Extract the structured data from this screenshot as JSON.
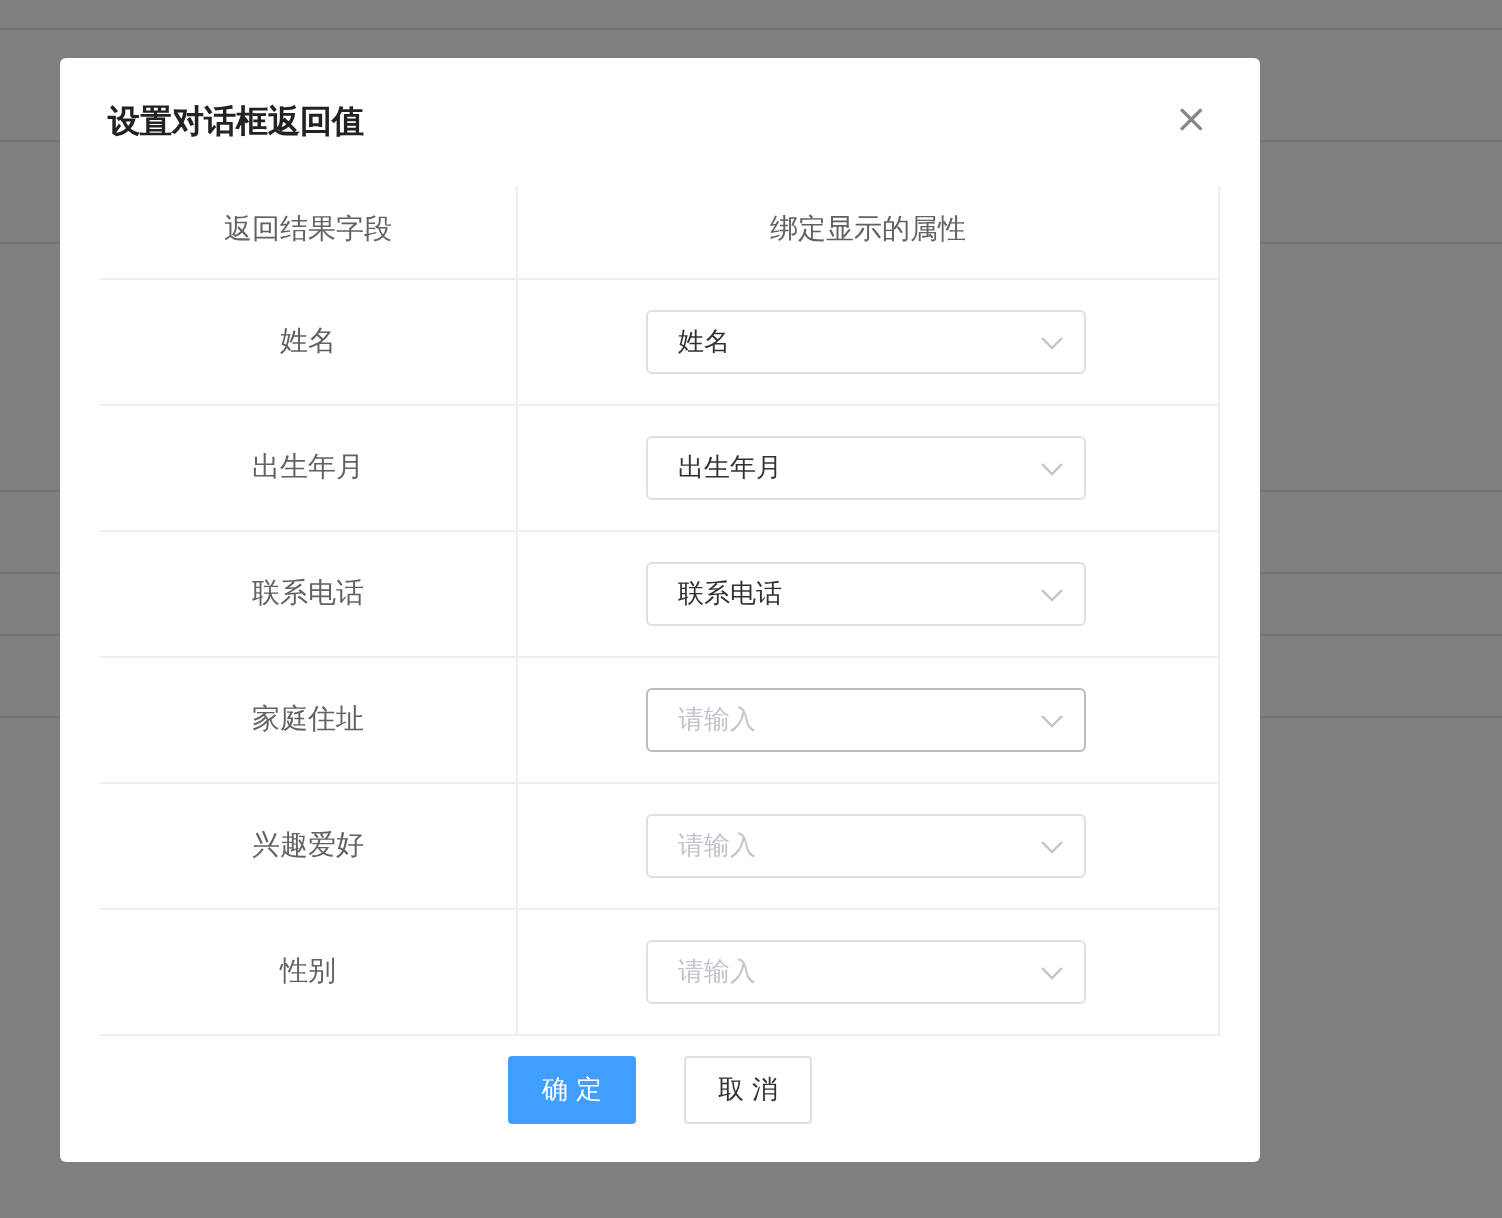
{
  "dialog": {
    "title": "设置对话框返回值",
    "close": "×",
    "table": {
      "columns": [
        "返回结果字段",
        "绑定显示的属性"
      ],
      "rows": [
        {
          "field": "姓名",
          "select": {
            "value": "姓名",
            "hovered": false
          }
        },
        {
          "field": "出生年月",
          "select": {
            "value": "出生年月",
            "hovered": false
          }
        },
        {
          "field": "联系电话",
          "select": {
            "value": "联系电话",
            "hovered": false
          }
        },
        {
          "field": "家庭住址",
          "select": {
            "placeholder": "请输入",
            "hovered": true
          }
        },
        {
          "field": "兴趣爱好",
          "select": {
            "placeholder": "请输入",
            "hovered": false
          }
        },
        {
          "field": "性别",
          "select": {
            "placeholder": "请输入",
            "hovered": false
          }
        }
      ]
    },
    "buttons": [
      {
        "label": "确 定",
        "kind": "primary"
      },
      {
        "label": "取 消",
        "kind": "default"
      }
    ]
  }
}
